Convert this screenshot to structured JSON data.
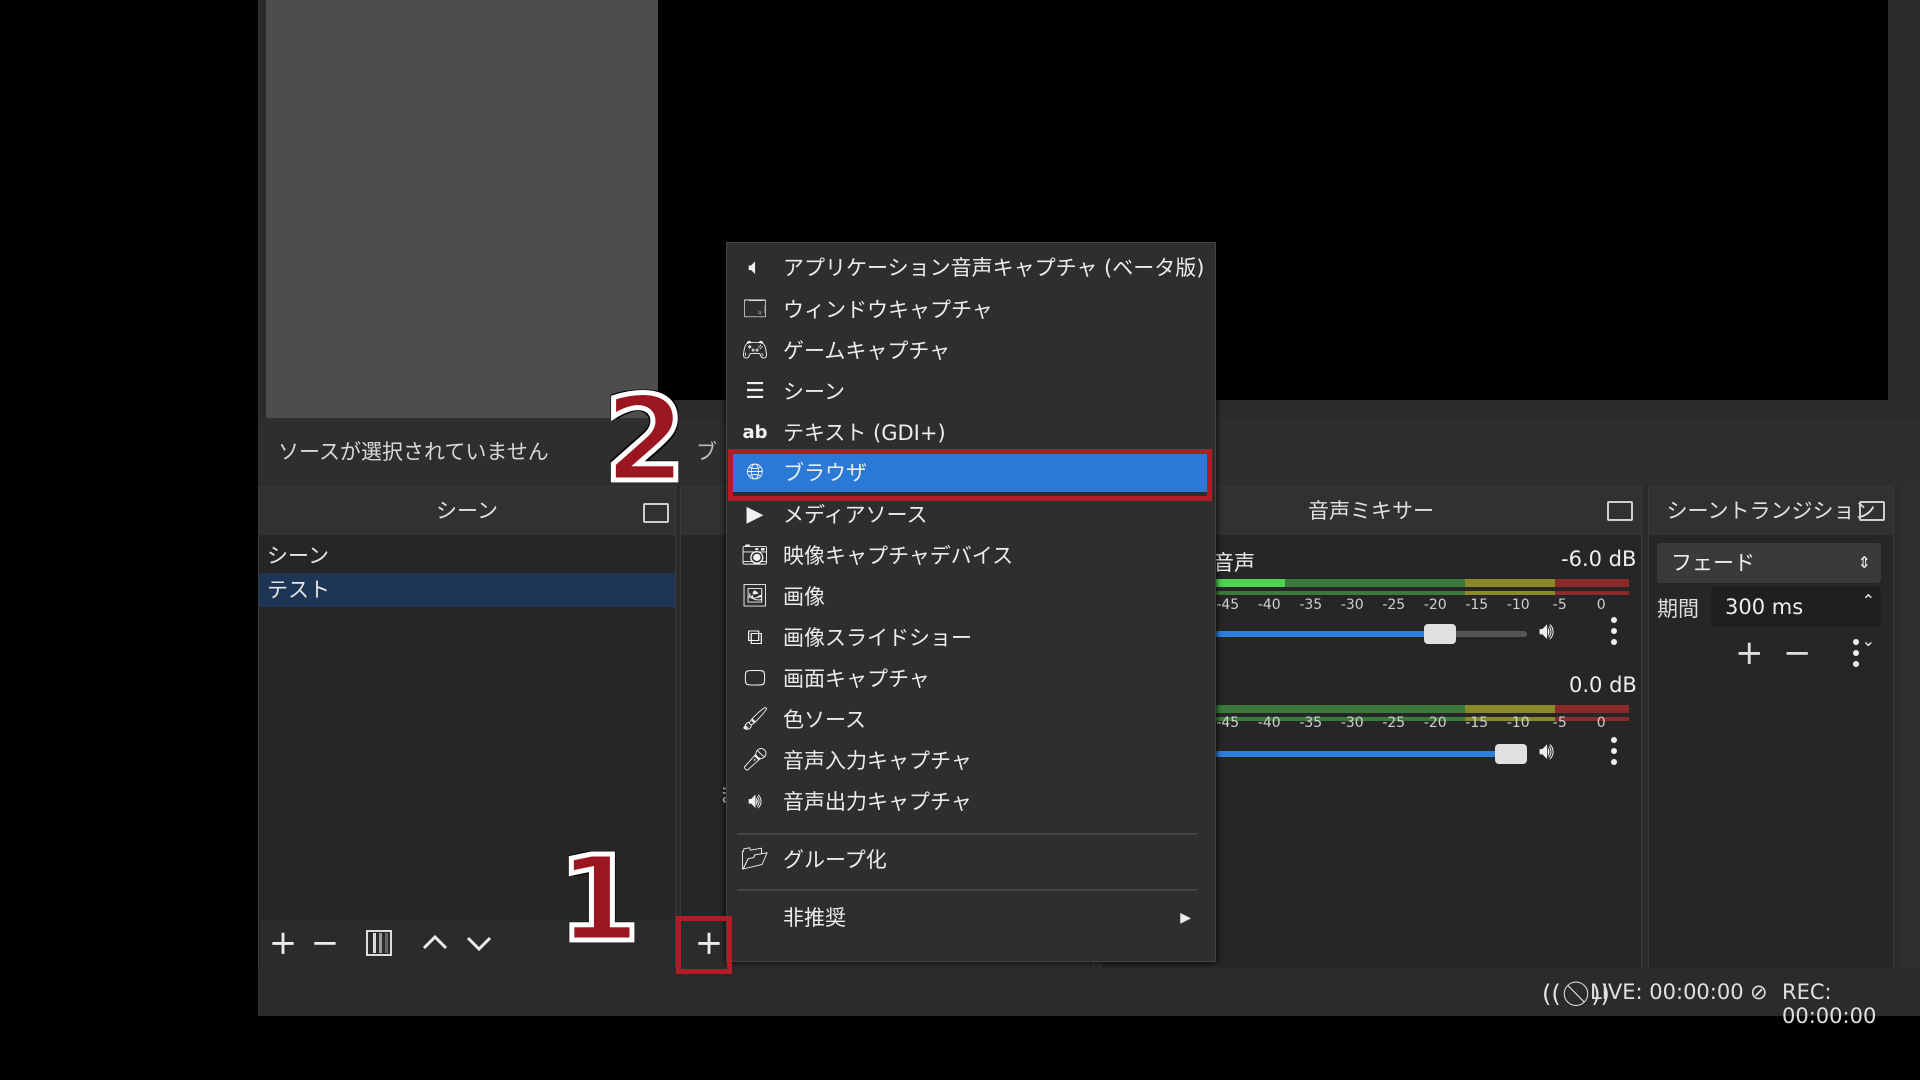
{
  "preview": {
    "no_source_text": "ソースが選択されていません"
  },
  "scenes_dock": {
    "title": "シーン",
    "items": [
      {
        "label": "シーン",
        "selected": false
      },
      {
        "label": "テスト",
        "selected": true
      }
    ],
    "toolbar": [
      "add",
      "remove",
      "filters",
      "move-up",
      "move-down"
    ]
  },
  "sources_dock": {
    "partial_text_1": "ブ",
    "partial_text_2": "ま"
  },
  "mixer": {
    "title": "音声ミキサー",
    "channels": [
      {
        "name": "音声",
        "db": "-6.0 dB",
        "level": 0.72
      },
      {
        "name": "",
        "db": "0.0 dB",
        "level": 1.0
      }
    ],
    "scale": [
      "-45",
      "-40",
      "-35",
      "-30",
      "-25",
      "-20",
      "-15",
      "-10",
      "-5",
      "0"
    ]
  },
  "transitions": {
    "title": "シーントランジション",
    "selected": "フェード",
    "duration_label": "期間",
    "duration_value": "300 ms"
  },
  "statusbar": {
    "live": "LIVE: 00:00:00",
    "rec": "REC: 00:00:00"
  },
  "context_menu": {
    "items": [
      {
        "label": "アプリケーション音声キャプチャ (ベータ版)",
        "icon": "app-audio-icon"
      },
      {
        "label": "ウィンドウキャプチャ",
        "icon": "window-icon"
      },
      {
        "label": "ゲームキャプチャ",
        "icon": "gamepad-icon"
      },
      {
        "label": "シーン",
        "icon": "list-icon"
      },
      {
        "label": "テキスト (GDI+)",
        "icon": "text-icon"
      },
      {
        "label": "ブラウザ",
        "icon": "globe-icon",
        "highlighted": true
      },
      {
        "label": "メディアソース",
        "icon": "play-icon"
      },
      {
        "label": "映像キャプチャデバイス",
        "icon": "camera-icon"
      },
      {
        "label": "画像",
        "icon": "image-icon"
      },
      {
        "label": "画像スライドショー",
        "icon": "slideshow-icon"
      },
      {
        "label": "画面キャプチャ",
        "icon": "monitor-icon"
      },
      {
        "label": "色ソース",
        "icon": "brush-icon"
      },
      {
        "label": "音声入力キャプチャ",
        "icon": "microphone-icon"
      },
      {
        "label": "音声出力キャプチャ",
        "icon": "speaker-icon"
      },
      {
        "label": "グループ化",
        "icon": "folder-icon"
      },
      {
        "label": "非推奨",
        "icon": "",
        "submenu": true
      }
    ]
  },
  "annotations": {
    "step1": "1",
    "step2": "2"
  },
  "colors": {
    "highlight": "#2b79d6",
    "callout_red": "#9b1620",
    "accent_blue": "#2d7fdc"
  }
}
